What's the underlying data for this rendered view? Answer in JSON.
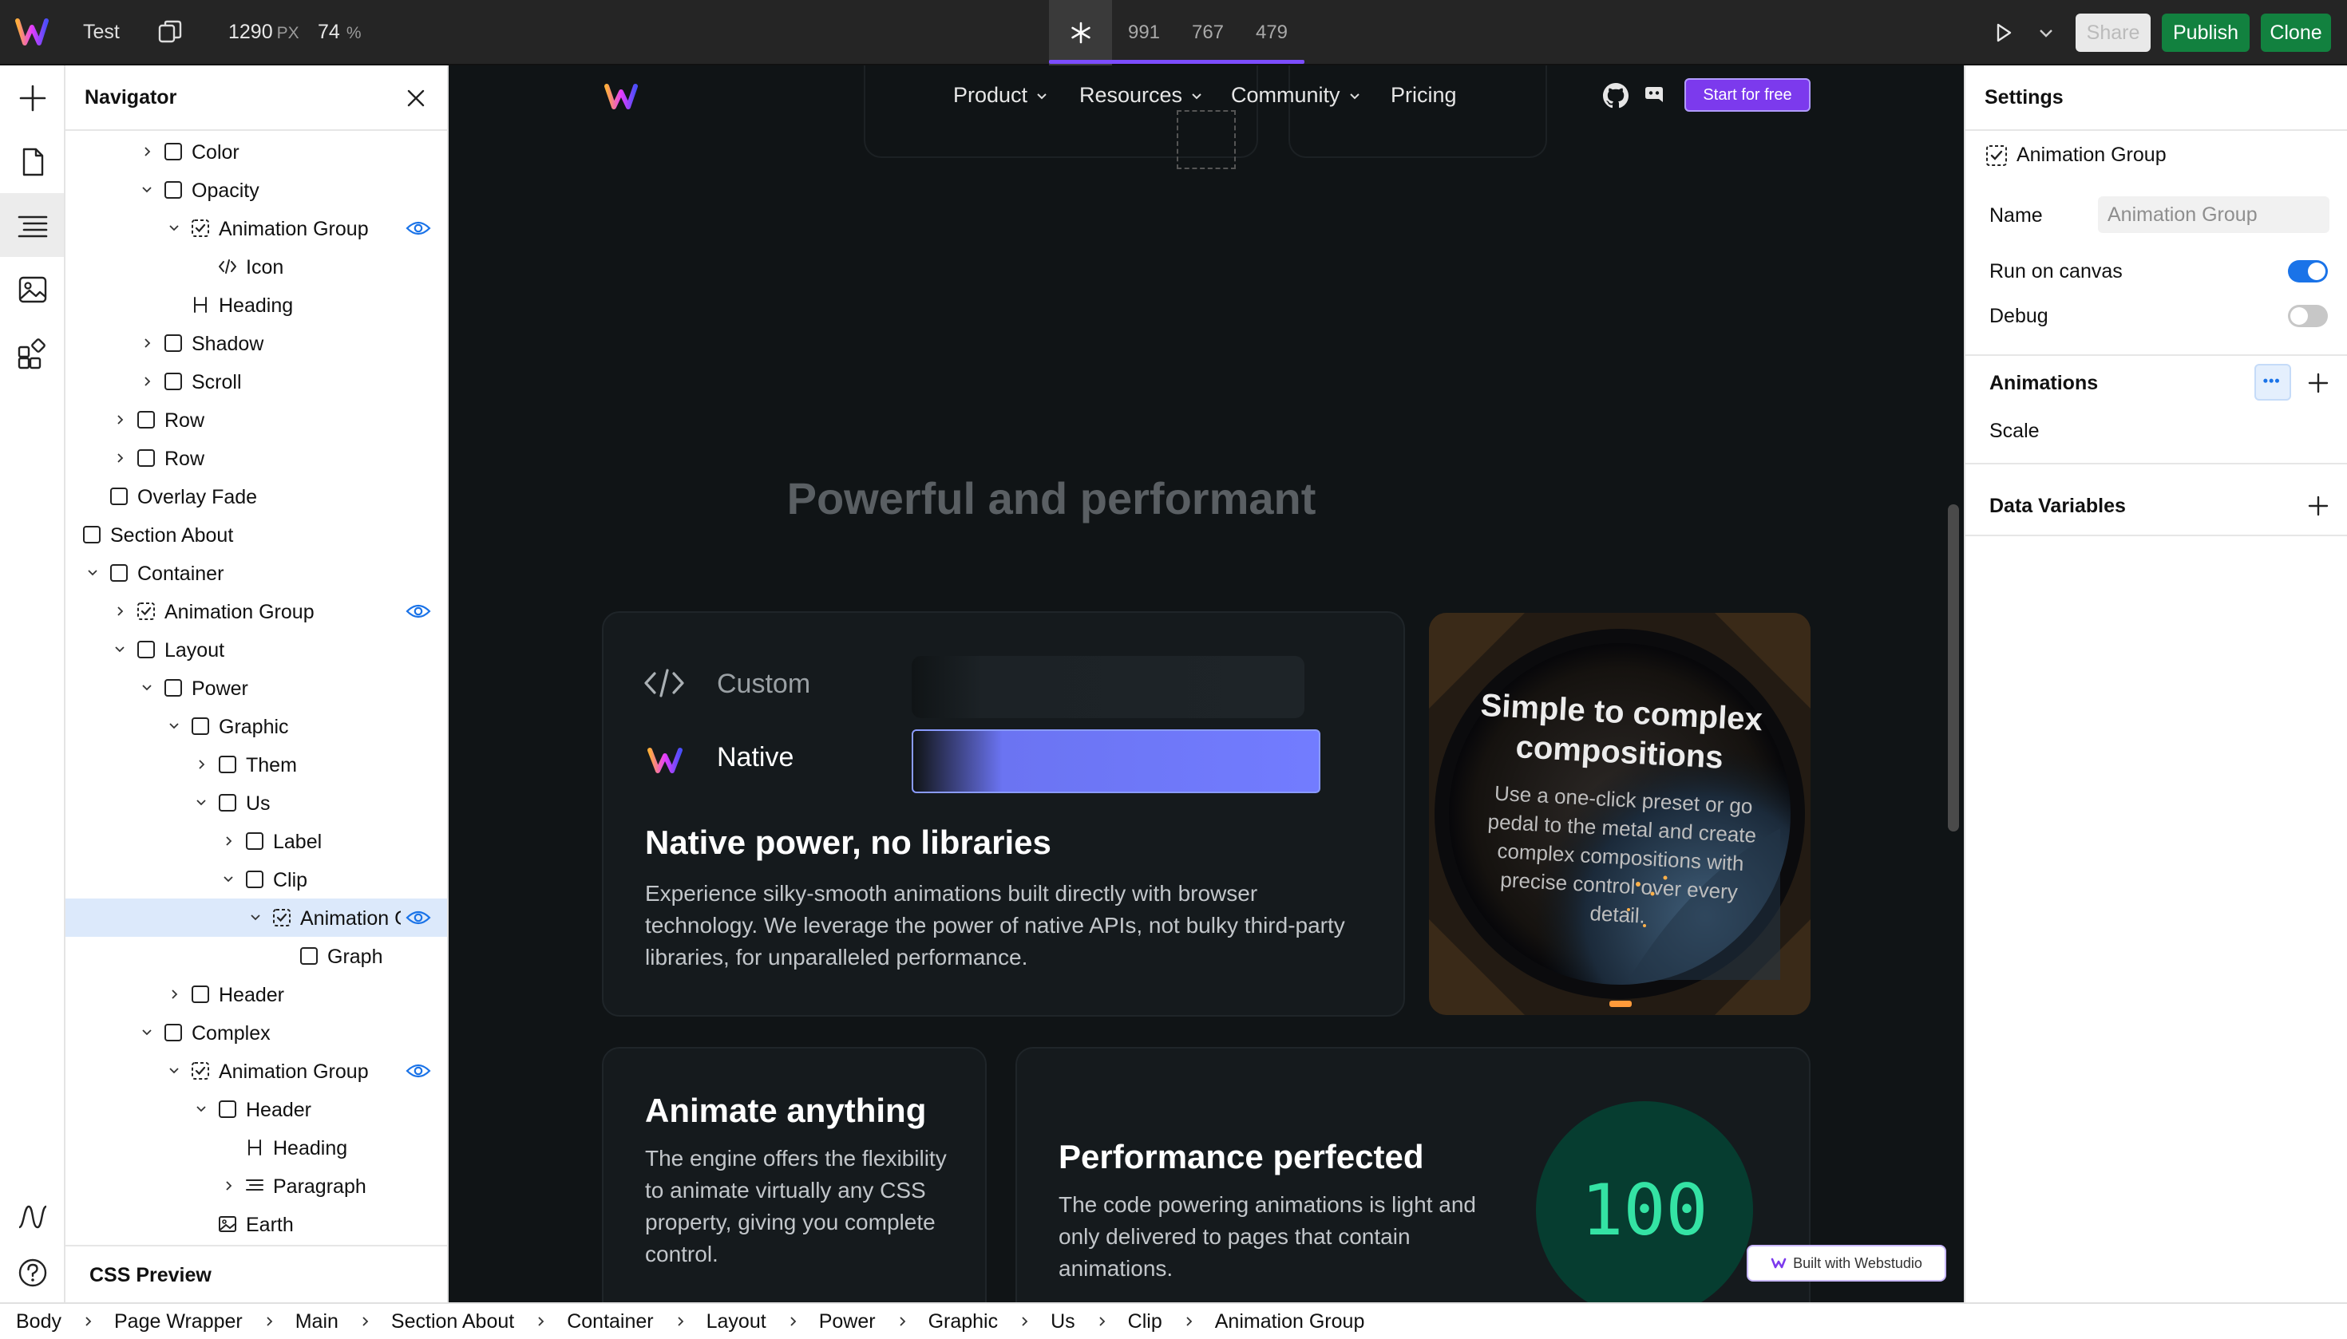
{
  "topbar": {
    "project_name": "Test",
    "width_value": "1290",
    "width_unit": "PX",
    "zoom_value": "74",
    "zoom_unit": "%",
    "breakpoints": [
      "991",
      "767",
      "479"
    ],
    "share_label": "Share",
    "publish_label": "Publish",
    "clone_label": "Clone"
  },
  "rail": {
    "icons": [
      "add-icon",
      "pages-icon",
      "navigator-icon",
      "assets-icon",
      "components-icon",
      "animation-icon",
      "help-icon"
    ]
  },
  "navigator": {
    "title": "Navigator",
    "footer_label": "CSS Preview",
    "items": [
      {
        "label": "Color",
        "expanded": false,
        "icon": "box-icon"
      },
      {
        "label": "Opacity",
        "expanded": true,
        "icon": "box-icon"
      },
      {
        "label": "Animation Group",
        "expanded": true,
        "icon": "animation-group-icon",
        "visible": true
      },
      {
        "label": "Icon",
        "icon": "code-icon"
      },
      {
        "label": "Heading",
        "icon": "heading-icon"
      },
      {
        "label": "Shadow",
        "expanded": false,
        "icon": "box-icon"
      },
      {
        "label": "Scroll",
        "expanded": false,
        "icon": "box-icon"
      },
      {
        "label": "Row",
        "expanded": false,
        "icon": "box-icon"
      },
      {
        "label": "Row",
        "expanded": false,
        "icon": "box-icon"
      },
      {
        "label": "Overlay Fade",
        "icon": "box-icon"
      },
      {
        "label": "Section About",
        "icon": "box-icon"
      },
      {
        "label": "Container",
        "expanded": true,
        "icon": "box-icon"
      },
      {
        "label": "Animation Group",
        "expanded": false,
        "icon": "animation-group-icon",
        "visible": true
      },
      {
        "label": "Layout",
        "expanded": true,
        "icon": "box-icon"
      },
      {
        "label": "Power",
        "expanded": true,
        "icon": "box-icon"
      },
      {
        "label": "Graphic",
        "expanded": true,
        "icon": "box-icon"
      },
      {
        "label": "Them",
        "expanded": false,
        "icon": "box-icon"
      },
      {
        "label": "Us",
        "expanded": true,
        "icon": "box-icon"
      },
      {
        "label": "Label",
        "expanded": false,
        "icon": "box-icon"
      },
      {
        "label": "Clip",
        "expanded": true,
        "icon": "box-icon"
      },
      {
        "label": "Animation Gı",
        "expanded": true,
        "icon": "animation-group-icon",
        "visible": true,
        "selected": true
      },
      {
        "label": "Graph",
        "icon": "box-icon"
      },
      {
        "label": "Header",
        "expanded": false,
        "icon": "box-icon"
      },
      {
        "label": "Complex",
        "expanded": true,
        "icon": "box-icon"
      },
      {
        "label": "Animation Group",
        "expanded": true,
        "icon": "animation-group-icon",
        "visible": true
      },
      {
        "label": "Header",
        "expanded": true,
        "icon": "box-icon"
      },
      {
        "label": "Heading",
        "icon": "heading-icon"
      },
      {
        "label": "Paragraph",
        "expanded": false,
        "icon": "paragraph-icon"
      },
      {
        "label": "Earth",
        "icon": "image-icon"
      }
    ]
  },
  "canvas": {
    "nav": {
      "links": [
        "Product",
        "Resources",
        "Community",
        "Pricing"
      ],
      "cta": "Start for free"
    },
    "section_title": "Powerful and performant",
    "native_card": {
      "custom_label": "Custom",
      "native_label": "Native",
      "heading": "Native power, no libraries",
      "body": "Experience silky-smooth animations built directly with browser technology. We leverage the power of native APIs, not bulky third-party libraries, for unparalleled performance."
    },
    "image_card": {
      "title": "Simple to complex compositions",
      "text": "Use a one-click preset or go pedal to the metal and create complex compositions with precise control over every detail."
    },
    "animate_card": {
      "heading": "Animate anything",
      "body": "The engine offers the flexibility to animate virtually any CSS property, giving you complete control."
    },
    "perf_card": {
      "heading": "Performance perfected",
      "body": "The code powering animations is light and only delivered to pages that contain animations.",
      "score": "100"
    },
    "badge": "Built with Webstudio"
  },
  "settings": {
    "title": "Settings",
    "component_label": "Animation Group",
    "name_label": "Name",
    "name_placeholder": "Animation Group",
    "run_on_canvas_label": "Run on canvas",
    "run_on_canvas": true,
    "debug_label": "Debug",
    "debug": false,
    "animations_label": "Animations",
    "animation_items": [
      "Scale"
    ],
    "data_variables_label": "Data Variables"
  },
  "breadcrumb": [
    "Body",
    "Page Wrapper",
    "Main",
    "Section About",
    "Container",
    "Layout",
    "Power",
    "Graphic",
    "Us",
    "Clip",
    "Animation Group"
  ],
  "colors": {
    "accent": "#7c3aed",
    "publish": "#12813f",
    "toggle_on": "#1a73e8",
    "score_text": "#34e3a4",
    "native_bar": "#727cff"
  }
}
